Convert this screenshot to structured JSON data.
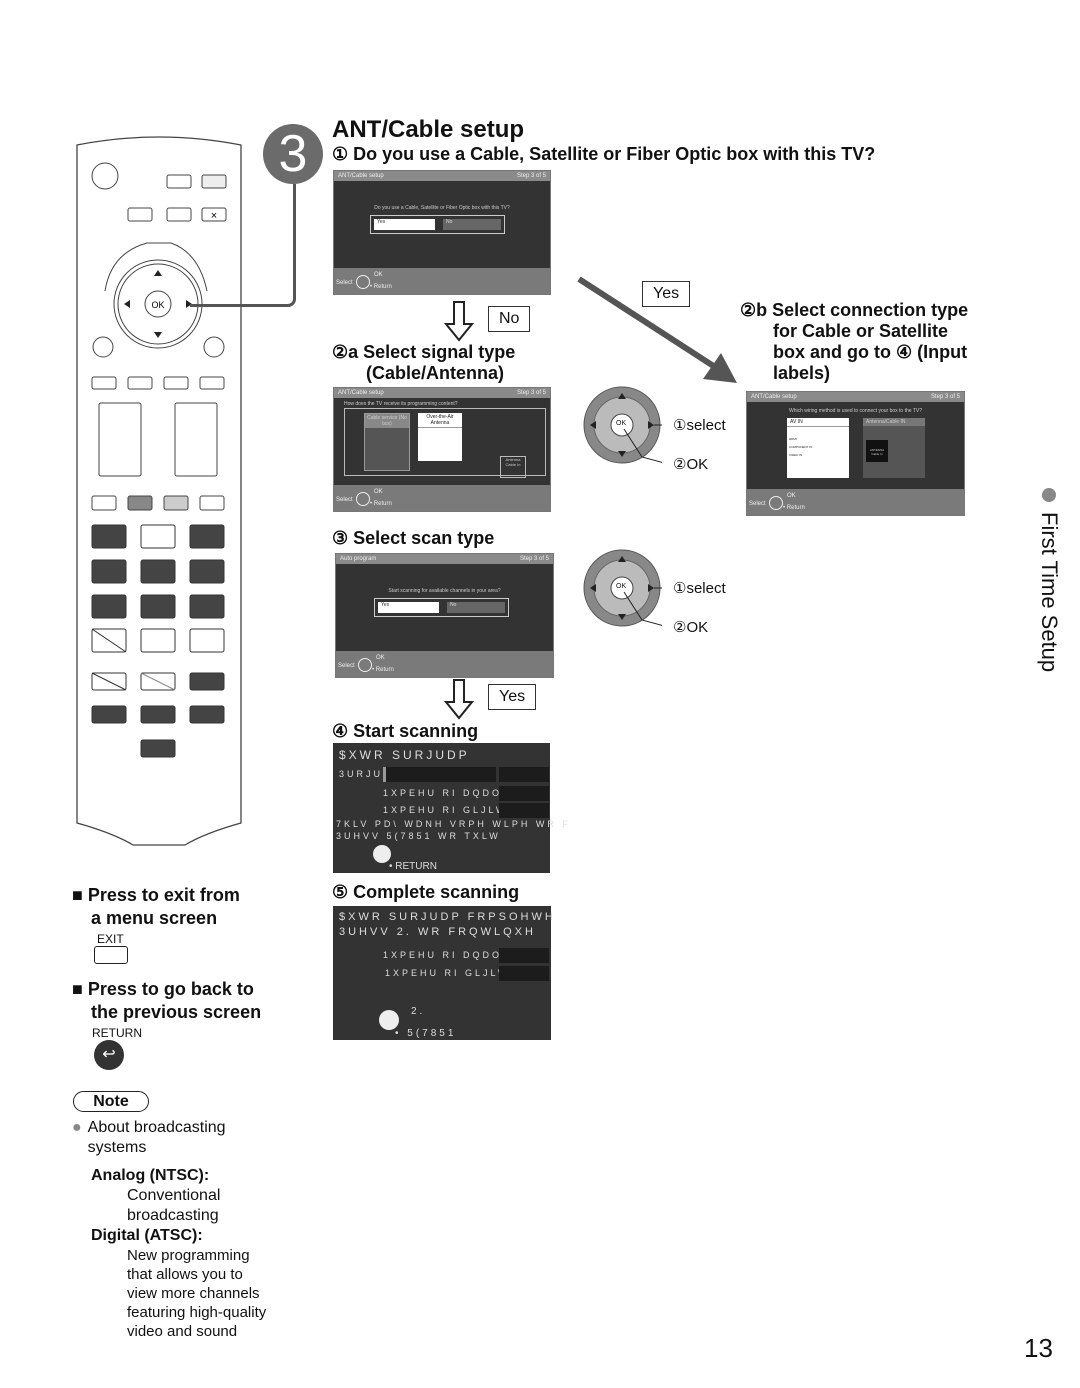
{
  "page": {
    "section_label": "First Time Setup",
    "page_number": "13"
  },
  "step": {
    "number": "3",
    "title": "ANT/Cable setup",
    "question": "① Do you use a Cable, Satellite or Fiber Optic box with this TV?"
  },
  "screen1": {
    "header_left": "ANT/Cable setup",
    "header_right": "Step 3 of 5",
    "question": "Do you use a Cable, Satellite or Fiber Optic box with this TV?",
    "yes": "Yes",
    "no": "No",
    "footer_select": "Select",
    "footer_ok": "OK",
    "footer_return": "• Return"
  },
  "branch_no": {
    "answer": "No",
    "heading_line1": "②a Select signal type",
    "heading_line2": "(Cable/Antenna)"
  },
  "branch_yes": {
    "answer": "Yes",
    "heading_lines": [
      "②b Select connection type",
      "for Cable or Satellite",
      "box and go to ④ (Input",
      "labels)"
    ]
  },
  "screen2a": {
    "header_left": "ANT/Cable setup",
    "header_right": "Step 3 of 5",
    "question": "How does the TV receive its programming content?",
    "option1": "Cable service (No box)",
    "option2": "Over-the-Air Antenna",
    "jack_label": "Antenna Cable In",
    "footer_select": "Select",
    "footer_ok": "OK",
    "footer_return": "• Return"
  },
  "screen2b": {
    "header_left": "ANT/Cable setup",
    "header_right": "Step 3 of 5",
    "question": "Which wiring method is used to connect your box to the TV?",
    "option1": "AV IN",
    "option1_items": [
      "HDMI",
      "COMPONENT IN",
      "VIDEO IN"
    ],
    "option2": "Antenna/Cable IN",
    "option2_jack": "ANTENNA Cable In",
    "footer_select": "Select",
    "footer_ok": "OK",
    "footer_return": "• Return"
  },
  "dpad_hint1": {
    "select": "①select",
    "ok": "②OK",
    "ok_key": "OK"
  },
  "dpad_hint2": {
    "select": "①select",
    "ok": "②OK",
    "ok_key": "OK"
  },
  "step3": {
    "heading": "③ Select scan type"
  },
  "screen3": {
    "header_left": "Auto program",
    "header_right": "Step 3 of 5",
    "question": "Start scanning for available channels in your area?",
    "yes": "Yes",
    "no": "No",
    "footer_select": "Select",
    "footer_ok": "OK",
    "footer_return": "• Return"
  },
  "step3_answer": "Yes",
  "step4": {
    "heading": "④ Start scanning",
    "title": "$XWR SURJUDP",
    "progress_label": "3URJU",
    "line_analog": "1XPEHU RI DQDOR",
    "line_digital": "1XPEHU RI GLJLWD",
    "wait_line": "7KLV PD\\ WDNH VRPH WLPH WR F",
    "press_line": "3UHVV 5(7851 WR TXLW",
    "return_label": "• RETURN"
  },
  "step5": {
    "heading": "⑤ Complete scanning",
    "title": "$XWR SURJUDP FRPSOHWH",
    "press_line": "3UHVV 2. WR FRQWLQXH",
    "line_analog": "1XPEHU RI DQDOR",
    "line_digital": "1XPEHU RI GLJLWD",
    "ok_label": "2.",
    "return_label": "• 5(7851"
  },
  "remote": {
    "ok_label": "OK"
  },
  "side_notes": {
    "exit_heading_line1": "Press to exit from",
    "exit_heading_line2": "a menu screen",
    "exit_key": "EXIT",
    "return_heading_line1": "Press to go back to",
    "return_heading_line2": "the previous screen",
    "return_key": "RETURN"
  },
  "note": {
    "label": "Note",
    "bullet": "About broadcasting systems",
    "analog_title": "Analog (NTSC):",
    "analog_desc": "Conventional broadcasting",
    "digital_title": "Digital (ATSC):",
    "digital_desc": "New programming that allows you to view more channels featuring high-quality video and sound"
  }
}
